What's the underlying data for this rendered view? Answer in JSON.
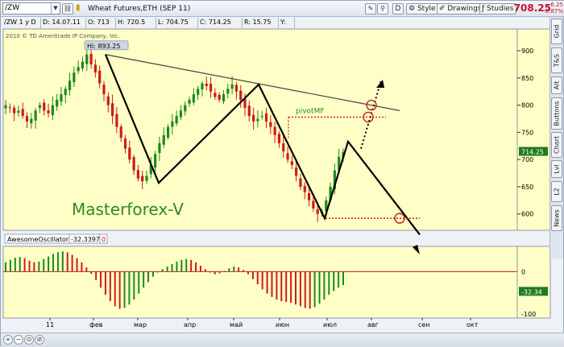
{
  "toolbar": {
    "symbol": "/ZW",
    "period_button": "1 y D",
    "description": "Wheat Futures,ETH (SEP 11)",
    "d_button": "D",
    "style_label": "Style",
    "drawings_label": "Drawings",
    "studies_label": "Studies",
    "last_price": "708.25",
    "change_abs": "-6.25",
    "change_pct": "-0.87%"
  },
  "info_bar": {
    "symbol_period": "/ZW 1 y D",
    "date": "D: 14.07.11",
    "open": "O: 713",
    "high": "H: 720.5",
    "low": "L: 704.75",
    "close": "C: 714.25",
    "range": "R: 15.75",
    "y": "Y:"
  },
  "copyright": "2010 © TD Ameritrade IP Company, Inc.",
  "hi_label": "Hi: 893.25",
  "annotations": {
    "pivot": "pivotMF",
    "brand": "Masterforex-V"
  },
  "price_axis": {
    "ticks": [
      "900",
      "850",
      "800",
      "750",
      "700",
      "650",
      "600"
    ],
    "current_label": "714.25"
  },
  "oscillator": {
    "name": "AwesomeOscillator",
    "value": "-32.3397",
    "second_value": "0",
    "axis_ticks": [
      "0",
      "-100"
    ],
    "current_label": "-32.34"
  },
  "time_axis": [
    "11",
    "фев",
    "мар",
    "апр",
    "май",
    "июн",
    "июл",
    "авг",
    "сен",
    "окт"
  ],
  "side_tabs": [
    "Grid",
    "T&S",
    "Alt",
    "Buttons",
    "Chart",
    "Lvl",
    "L2",
    "News"
  ],
  "colors": {
    "chart_bg": "#fffec6",
    "up_candle": "#1c8a1c",
    "down_candle": "#cc1b1b",
    "brand_text": "#2f8a1e",
    "price_red": "#c8102e"
  },
  "chart_data": {
    "type": "candlestick",
    "title": "Wheat Futures,ETH (SEP 11)",
    "xlabel": "",
    "ylabel": "",
    "ylim": [
      570,
      940
    ],
    "time_labels": [
      "11",
      "фев",
      "мар",
      "апр",
      "май",
      "июн",
      "июл",
      "авг",
      "сен",
      "окт"
    ],
    "key_levels": {
      "high": 893.25,
      "last": 714.25,
      "pivot": 778,
      "support": 590
    },
    "close_path": [
      800,
      795,
      785,
      790,
      780,
      770,
      775,
      790,
      800,
      790,
      785,
      800,
      810,
      820,
      830,
      845,
      860,
      870,
      880,
      893,
      875,
      860,
      840,
      820,
      800,
      780,
      760,
      740,
      720,
      700,
      680,
      665,
      660,
      670,
      690,
      710,
      730,
      745,
      760,
      770,
      780,
      790,
      800,
      810,
      820,
      830,
      840,
      835,
      825,
      815,
      810,
      820,
      830,
      838,
      825,
      810,
      795,
      780,
      770,
      775,
      780,
      770,
      760,
      745,
      730,
      715,
      700,
      690,
      670,
      650,
      640,
      625,
      610,
      600,
      605,
      625,
      650,
      680,
      705,
      714
    ],
    "oscillator": {
      "name": "AwesomeOscillator",
      "last": -32.34,
      "range": [
        -110,
        60
      ],
      "values": [
        22,
        28,
        33,
        35,
        32,
        26,
        22,
        24,
        30,
        36,
        42,
        46,
        48,
        46,
        40,
        32,
        22,
        10,
        -5,
        -20,
        -38,
        -55,
        -70,
        -82,
        -88,
        -86,
        -78,
        -66,
        -52,
        -38,
        -25,
        -12,
        -2,
        6,
        12,
        18,
        24,
        28,
        30,
        28,
        22,
        14,
        6,
        -2,
        -6,
        -4,
        2,
        8,
        12,
        10,
        4,
        -6,
        -18,
        -30,
        -42,
        -52,
        -60,
        -66,
        -70,
        -72,
        -74,
        -78,
        -82,
        -86,
        -88,
        -84,
        -76,
        -66,
        -55,
        -46,
        -38,
        -32
      ]
    }
  }
}
